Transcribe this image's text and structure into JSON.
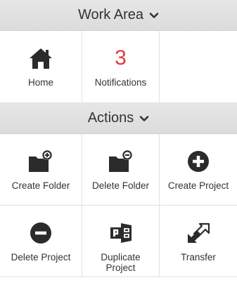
{
  "work_area": {
    "title": "Work Area",
    "tiles": [
      {
        "label": "Home",
        "icon": "home-icon"
      },
      {
        "label": "Notifications",
        "count": "3"
      }
    ]
  },
  "actions": {
    "title": "Actions",
    "tiles": [
      {
        "label": "Create Folder",
        "icon": "folder-plus-icon"
      },
      {
        "label": "Delete Folder",
        "icon": "folder-minus-icon"
      },
      {
        "label": "Create Project",
        "icon": "plus-circle-icon"
      },
      {
        "label": "Delete Project",
        "icon": "minus-circle-icon"
      },
      {
        "label": "Duplicate Project",
        "icon": "duplicate-project-icon"
      },
      {
        "label": "Transfer",
        "icon": "transfer-arrows-icon"
      }
    ]
  },
  "colors": {
    "icon": "#2b2b2b",
    "notification_count": "#e0393e",
    "header_bg": "#e0e0e0"
  }
}
